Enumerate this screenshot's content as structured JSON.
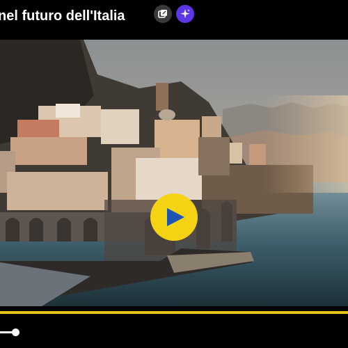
{
  "header": {
    "title": "nel futuro dell'Italia"
  },
  "controls": {
    "pip_icon": "picture-in-picture-icon",
    "sparkle_icon": "sparkle-icon",
    "play_icon": "play-icon",
    "accent_color": "#e9c519",
    "ai_color": "#5b35e6"
  },
  "player": {
    "progress_fraction": 0.0,
    "seek_fraction": 0.04
  }
}
